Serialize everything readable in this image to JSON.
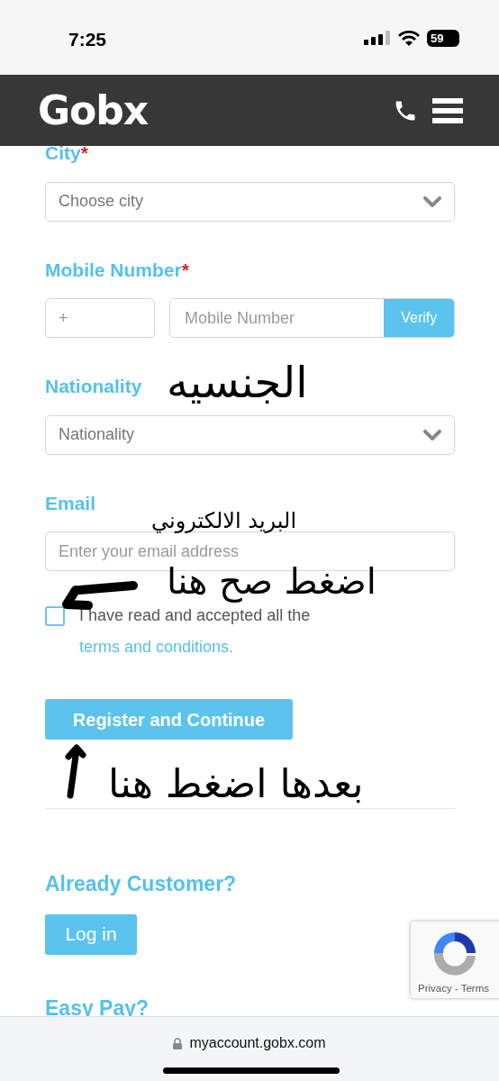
{
  "status_bar": {
    "time": "7:25",
    "battery": "59"
  },
  "header": {
    "logo": "Gobx"
  },
  "fields": [
    {
      "kind": "select",
      "label": "City",
      "required_mark": "*",
      "placeholder": "Choose city"
    },
    {
      "kind": "phone",
      "label": "Mobile Number",
      "required_mark": "*",
      "prefix_placeholder": "+",
      "placeholder": "Mobile Number",
      "button": "Verify"
    },
    {
      "kind": "select",
      "label": "Nationality",
      "placeholder": "Nationality"
    },
    {
      "kind": "input",
      "label": "Email",
      "placeholder": "Enter your email address"
    }
  ],
  "terms": {
    "checked": false,
    "text": "I have read and accepted all the",
    "link": "terms and conditions."
  },
  "register_button": "Register and Continue",
  "login_section": {
    "heading": "Already Customer?",
    "button": "Log in"
  },
  "easy_pay": {
    "heading": "Easy Pay?"
  },
  "recaptcha": {
    "links": "Privacy - Terms"
  },
  "browser": {
    "url": "myaccount.gobx.com"
  },
  "annotations": [
    {
      "kind": "text",
      "text": "الجنسيه"
    },
    {
      "kind": "text",
      "text": "البريد الالكتروني"
    },
    {
      "kind": "arrow-left"
    },
    {
      "kind": "text",
      "text": "اضغط صح هنا"
    },
    {
      "kind": "arrow-up"
    },
    {
      "kind": "text",
      "text": "بعدها اضغط هنا"
    }
  ]
}
